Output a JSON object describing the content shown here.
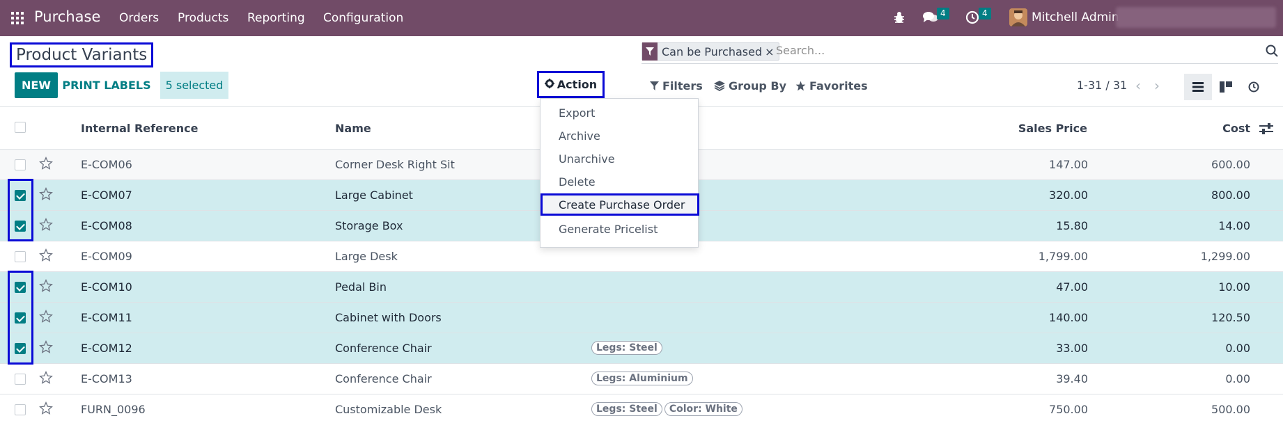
{
  "navbar": {
    "app_name": "Purchase",
    "menus": [
      "Orders",
      "Products",
      "Reporting",
      "Configuration"
    ],
    "messages_count": "4",
    "activities_count": "4",
    "user_name": "Mitchell Admin"
  },
  "control_panel": {
    "title": "Product Variants",
    "facet_label": "Can be Purchased",
    "search_placeholder": "Search...",
    "new_label": "NEW",
    "print_labels_label": "PRINT LABELS",
    "selected_label": "5 selected",
    "action_label": "Action",
    "filters_label": "Filters",
    "groupby_label": "Group By",
    "favorites_label": "Favorites",
    "pager_label": "1-31 / 31"
  },
  "table": {
    "headers": {
      "ref": "Internal Reference",
      "name": "Name",
      "price": "Sales Price",
      "cost": "Cost"
    },
    "rows": [
      {
        "ref": "E-COM06",
        "name": "Corner Desk Right Sit",
        "tags": [],
        "price": "147.00",
        "cost": "600.00",
        "selected": false
      },
      {
        "ref": "E-COM07",
        "name": "Large Cabinet",
        "tags": [],
        "price": "320.00",
        "cost": "800.00",
        "selected": true
      },
      {
        "ref": "E-COM08",
        "name": "Storage Box",
        "tags": [],
        "price": "15.80",
        "cost": "14.00",
        "selected": true
      },
      {
        "ref": "E-COM09",
        "name": "Large Desk",
        "tags": [],
        "price": "1,799.00",
        "cost": "1,299.00",
        "selected": false
      },
      {
        "ref": "E-COM10",
        "name": "Pedal Bin",
        "tags": [],
        "price": "47.00",
        "cost": "10.00",
        "selected": true
      },
      {
        "ref": "E-COM11",
        "name": "Cabinet with Doors",
        "tags": [],
        "price": "140.00",
        "cost": "120.50",
        "selected": true
      },
      {
        "ref": "E-COM12",
        "name": "Conference Chair",
        "tags": [
          "Legs: Steel"
        ],
        "price": "33.00",
        "cost": "0.00",
        "selected": true
      },
      {
        "ref": "E-COM13",
        "name": "Conference Chair",
        "tags": [
          "Legs: Aluminium"
        ],
        "price": "39.40",
        "cost": "0.00",
        "selected": false
      },
      {
        "ref": "FURN_0096",
        "name": "Customizable Desk",
        "tags": [
          "Legs: Steel",
          "Color: White"
        ],
        "price": "750.00",
        "cost": "500.00",
        "selected": false
      }
    ]
  },
  "action_menu": {
    "items": [
      "Export",
      "Archive",
      "Unarchive",
      "Delete",
      "Create Purchase Order",
      "Generate Pricelist"
    ],
    "highlighted": "Create Purchase Order"
  },
  "colors": {
    "navbar": "#714b67",
    "primary": "#017e84",
    "selection": "#d0ecef",
    "annotation": "#0a0ad6"
  }
}
